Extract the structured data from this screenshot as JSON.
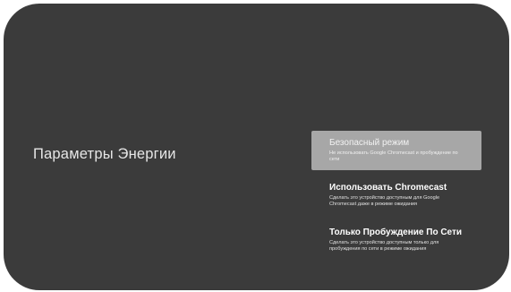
{
  "page": {
    "title": "Параметры Энергии"
  },
  "options": [
    {
      "title": "Безопасный режим",
      "description": "Не использовать Google Chromecast и пробуждение по сети",
      "selected": true
    },
    {
      "title": "Использовать Chromecast",
      "description": "Сделать это устройство доступным для Google Chromecast даже в режиме ожидания",
      "selected": false
    },
    {
      "title": "Только Пробуждение По Сети",
      "description": "Сделать это устройство доступным только для пробуждения по сети в режиме ожидания",
      "selected": false
    }
  ],
  "colors": {
    "background": "#3b3b3b",
    "selected_highlight": "#a7a7a7",
    "text": "#ffffff"
  }
}
